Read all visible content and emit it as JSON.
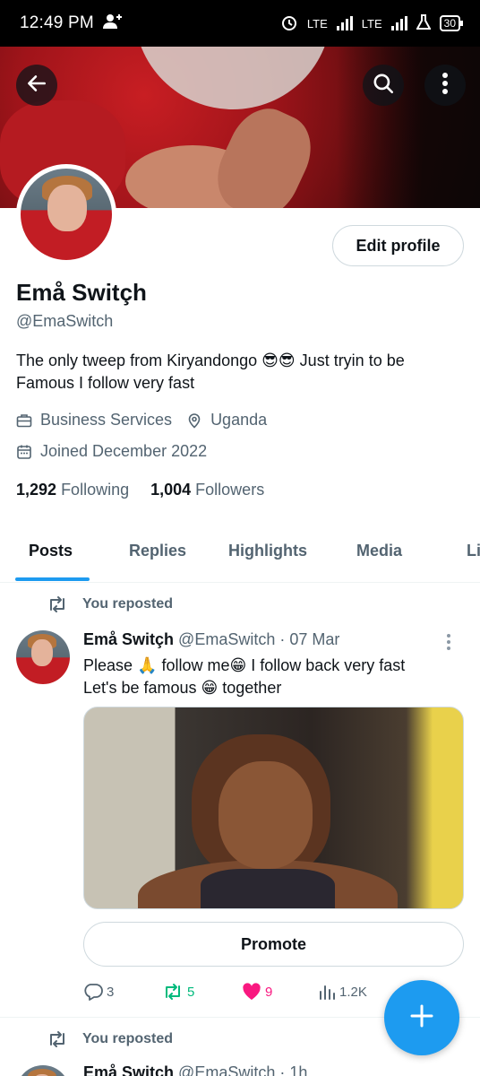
{
  "status_bar": {
    "time": "12:49 PM",
    "network_label": "LTE",
    "battery": "30"
  },
  "profile": {
    "display_name": "Emå Switçh",
    "handle": "@EmaSwitch",
    "bio": "The only tweep from Kiryandongo 😎😎 Just tryin to be Famous I follow very fast",
    "category": "Business Services",
    "location": "Uganda",
    "joined": "Joined December 2022",
    "following_count": "1,292",
    "following_label": "Following",
    "followers_count": "1,004",
    "followers_label": "Followers",
    "edit_profile_label": "Edit profile"
  },
  "tabs": [
    {
      "label": "Posts",
      "active": true
    },
    {
      "label": "Replies"
    },
    {
      "label": "Highlights"
    },
    {
      "label": "Media"
    },
    {
      "label": "Li"
    }
  ],
  "posts": [
    {
      "repost_label": "You reposted",
      "author_name": "Emå Switçh",
      "author_handle": "@EmaSwitch",
      "time": "· 07 Mar",
      "text_line1": "Please 🙏 follow me😁 I follow back very fast",
      "text_line2": "Let's be famous 😁 together",
      "promote_label": "Promote",
      "replies": "3",
      "reposts": "5",
      "likes": "9",
      "views": "1.2K"
    },
    {
      "repost_label": "You reposted",
      "author_name": "Emå Switch",
      "author_handle": "@EmaSwitch",
      "time": "· 1h"
    }
  ],
  "colors": {
    "accent": "#1d9bf0",
    "repost_green": "#00ba7c",
    "like_pink": "#f91880",
    "secondary_text": "#536471"
  },
  "icons": {
    "back": "arrow-left-icon",
    "search": "search-icon",
    "more": "more-vertical-icon",
    "category": "briefcase-icon",
    "location": "location-pin-icon",
    "joined": "calendar-icon",
    "repost": "repost-icon",
    "reply": "reply-icon",
    "like": "heart-icon",
    "views": "views-chart-icon",
    "compose": "plus-icon"
  }
}
